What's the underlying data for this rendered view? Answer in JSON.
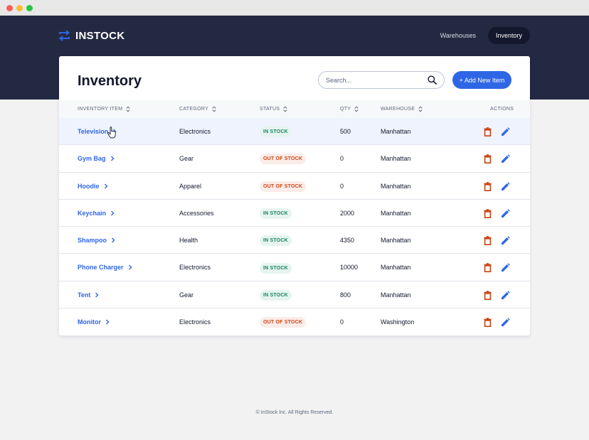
{
  "app": {
    "name": "INSTOCK",
    "nav": [
      {
        "label": "Warehouses",
        "active": false
      },
      {
        "label": "Inventory",
        "active": true
      }
    ]
  },
  "page": {
    "title": "Inventory",
    "search_placeholder": "Search...",
    "add_button_label": "+ Add New Item"
  },
  "table": {
    "columns": {
      "item": "INVENTORY ITEM",
      "category": "CATEGORY",
      "status": "STATUS",
      "qty": "QTY",
      "warehouse": "WAREHOUSE",
      "actions": "ACTIONS"
    },
    "rows": [
      {
        "item": "Television",
        "category": "Electronics",
        "status": "IN STOCK",
        "in_stock": true,
        "qty": "500",
        "warehouse": "Manhattan"
      },
      {
        "item": "Gym Bag",
        "category": "Gear",
        "status": "OUT OF STOCK",
        "in_stock": false,
        "qty": "0",
        "warehouse": "Manhattan"
      },
      {
        "item": "Hoodie",
        "category": "Apparel",
        "status": "OUT OF STOCK",
        "in_stock": false,
        "qty": "0",
        "warehouse": "Manhattan"
      },
      {
        "item": "Keychain",
        "category": "Accessories",
        "status": "IN STOCK",
        "in_stock": true,
        "qty": "2000",
        "warehouse": "Manhattan"
      },
      {
        "item": "Shampoo",
        "category": "Health",
        "status": "IN STOCK",
        "in_stock": true,
        "qty": "4350",
        "warehouse": "Manhattan"
      },
      {
        "item": "Phone Charger",
        "category": "Electronics",
        "status": "IN STOCK",
        "in_stock": true,
        "qty": "10000",
        "warehouse": "Manhattan"
      },
      {
        "item": "Tent",
        "category": "Gear",
        "status": "IN STOCK",
        "in_stock": true,
        "qty": "800",
        "warehouse": "Manhattan"
      },
      {
        "item": "Monitor",
        "category": "Electronics",
        "status": "OUT OF STOCK",
        "in_stock": false,
        "qty": "0",
        "warehouse": "Washington"
      }
    ]
  },
  "footer": {
    "text": "© InStock Inc. All Rights Reserved."
  },
  "icons": {
    "logo": "arrows-swap-icon",
    "search": "search-icon",
    "sort": "sort-icon",
    "chevron": "chevron-right-icon",
    "delete": "trash-icon",
    "edit": "pencil-icon"
  },
  "colors": {
    "header_bg": "#232940",
    "accent": "#2e66e5",
    "in_stock": "#158463",
    "out_of_stock": "#c94515",
    "delete_icon": "#c94515"
  }
}
